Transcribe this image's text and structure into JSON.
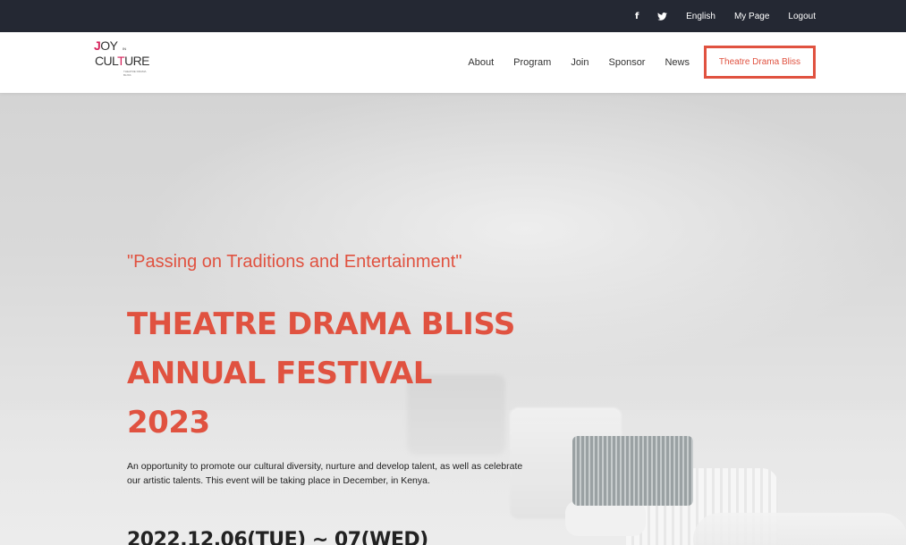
{
  "topbar": {
    "social": [
      {
        "icon": "facebook-icon",
        "glyph": "f"
      },
      {
        "icon": "twitter-icon",
        "glyph": "🐦"
      }
    ],
    "links": [
      "English",
      "My Page",
      "Logout"
    ],
    "background": "#242833"
  },
  "logo": {
    "line1_j": "J",
    "line1_rest": "OY",
    "line1_in": "IN",
    "line2_a": "CUL",
    "line2_t": "T",
    "line2_b": "URE",
    "sub": "THEATRE DRAMA BLISS"
  },
  "nav": {
    "items": [
      "About",
      "Program",
      "Join",
      "Sponsor",
      "News"
    ],
    "cta": "Theatre Drama Bliss"
  },
  "hero": {
    "tagline": "\"Passing on Traditions and Entertainment\"",
    "title_lines": [
      "THEATRE DRAMA BLISS",
      "ANNUAL FESTIVAL",
      "2023"
    ],
    "description": "An opportunity to promote our cultural diversity, nurture and develop talent, as well as celebrate our artistic talents. This event will be taking place in December, in Kenya.",
    "date": "2022.12.06(TUE) ~ 07(WED)"
  },
  "colors": {
    "accent": "#e05240",
    "logo_accent": "#d6245c"
  }
}
